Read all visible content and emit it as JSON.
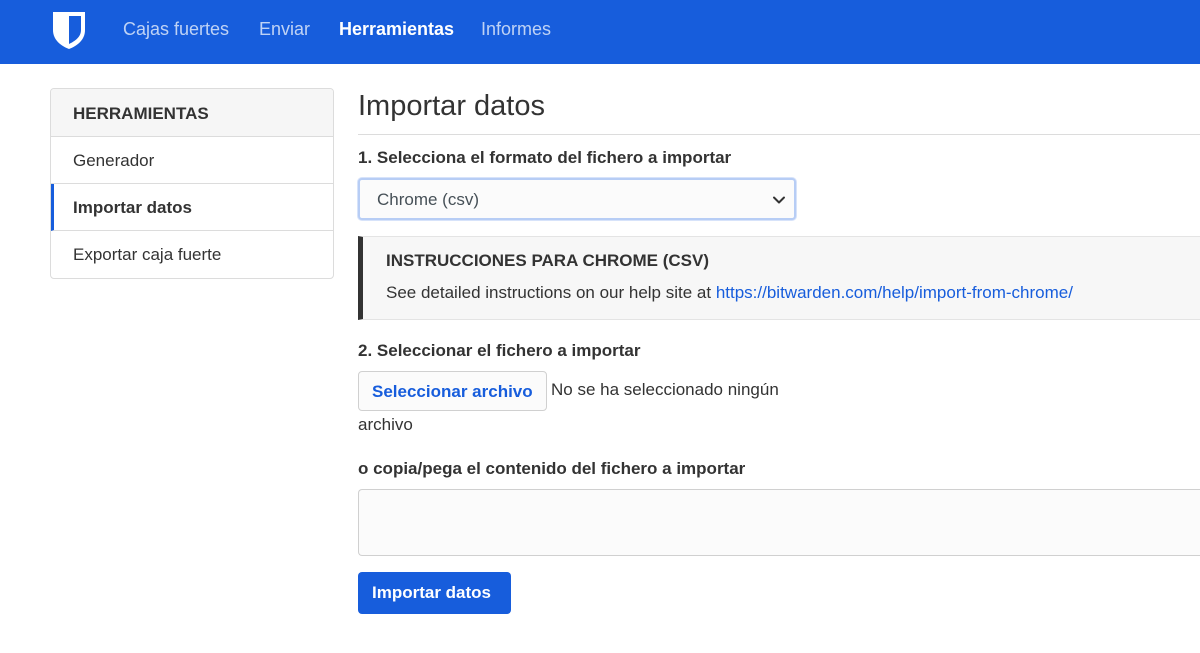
{
  "nav": {
    "items": [
      {
        "label": "Cajas fuertes",
        "active": false
      },
      {
        "label": "Enviar",
        "active": false
      },
      {
        "label": "Herramientas",
        "active": true
      },
      {
        "label": "Informes",
        "active": false
      }
    ],
    "logo_icon": "bitwarden-shield-icon",
    "bg_color": "#175ddc"
  },
  "sidebar": {
    "heading": "HERRAMIENTAS",
    "items": [
      {
        "label": "Generador",
        "active": false
      },
      {
        "label": "Importar datos",
        "active": true
      },
      {
        "label": "Exportar caja fuerte",
        "active": false
      }
    ]
  },
  "main": {
    "title": "Importar datos",
    "step1_label": "1. Selecciona el formato del fichero a importar",
    "format_select": {
      "value": "Chrome (csv)",
      "icon": "chevron-down-icon"
    },
    "instructions": {
      "title": "INSTRUCCIONES PARA CHROME (CSV)",
      "text": "See detailed instructions on our help site at ",
      "link": "https://bitwarden.com/help/import-from-chrome/"
    },
    "step2_label": "2. Seleccionar el fichero a importar",
    "file_button": "Seleccionar archivo",
    "file_status_line1": "No se ha seleccionado ningún",
    "file_status_line2": "archivo",
    "paste_label": "o copia/pega el contenido del fichero a importar",
    "paste_value": "",
    "submit_label": "Importar datos"
  }
}
